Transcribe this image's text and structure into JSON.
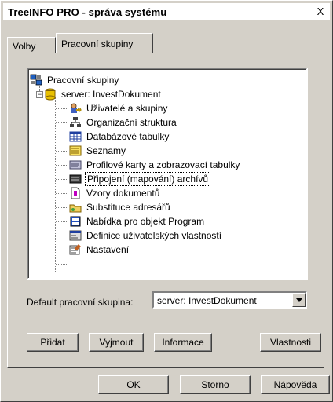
{
  "window": {
    "title": "TreeINFO PRO - správa systému",
    "close_label": "X"
  },
  "tabs": [
    {
      "label": "Volby"
    },
    {
      "label": "Pracovní skupiny"
    }
  ],
  "tree": {
    "root": "Pracovní skupiny",
    "server": "server: InvestDokument",
    "items": [
      {
        "label": "Uživatelé a skupiny",
        "icon": "users-key-icon"
      },
      {
        "label": "Organizační struktura",
        "icon": "org-chart-icon"
      },
      {
        "label": "Databázové tabulky",
        "icon": "table-icon"
      },
      {
        "label": "Seznamy",
        "icon": "list-icon"
      },
      {
        "label": "Profilové karty a zobrazovací tabulky",
        "icon": "profile-card-icon"
      },
      {
        "label": "Připojení (mapování) archívů",
        "icon": "archive-drive-icon"
      },
      {
        "label": "Vzory dokumentů",
        "icon": "document-template-icon"
      },
      {
        "label": "Substituce adresářů",
        "icon": "folder-substitute-icon"
      },
      {
        "label": "Nabídka pro objekt Program",
        "icon": "program-menu-icon"
      },
      {
        "label": "Definice uživatelských vlastností",
        "icon": "properties-icon"
      },
      {
        "label": "Nastavení",
        "icon": "settings-icon"
      }
    ]
  },
  "default_group": {
    "label": "Default pracovní skupina:",
    "value": "server: InvestDokument"
  },
  "actions": {
    "add": "Přidat",
    "remove": "Vyjmout",
    "info": "Informace",
    "properties": "Vlastnosti"
  },
  "footer": {
    "ok": "OK",
    "cancel": "Storno",
    "help": "Nápověda"
  }
}
